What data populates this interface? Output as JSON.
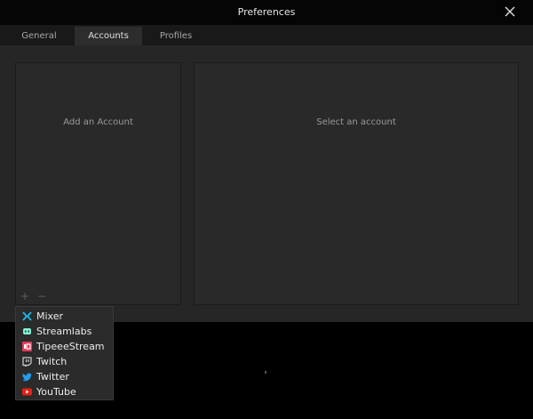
{
  "window": {
    "title": "Preferences"
  },
  "tabs": [
    {
      "label": "General",
      "active": false
    },
    {
      "label": "Accounts",
      "active": true
    },
    {
      "label": "Profiles",
      "active": false
    }
  ],
  "accounts_panel": {
    "placeholder": "Add an Account"
  },
  "details_panel": {
    "placeholder": "Select an account"
  },
  "list_controls": {
    "add": "+",
    "remove": "−"
  },
  "service_menu": {
    "items": [
      {
        "label": "Mixer",
        "icon": "mixer-icon",
        "color": "#1fbaed"
      },
      {
        "label": "Streamlabs",
        "icon": "streamlabs-icon",
        "color": "#80f5d2"
      },
      {
        "label": "TipeeeStream",
        "icon": "tipeeestream-icon",
        "color": "#e9395a"
      },
      {
        "label": "Twitch",
        "icon": "twitch-icon",
        "color": "#d0d0d0"
      },
      {
        "label": "Twitter",
        "icon": "twitter-icon",
        "color": "#1da1f2"
      },
      {
        "label": "YouTube",
        "icon": "youtube-icon",
        "color": "#e62117"
      }
    ]
  }
}
